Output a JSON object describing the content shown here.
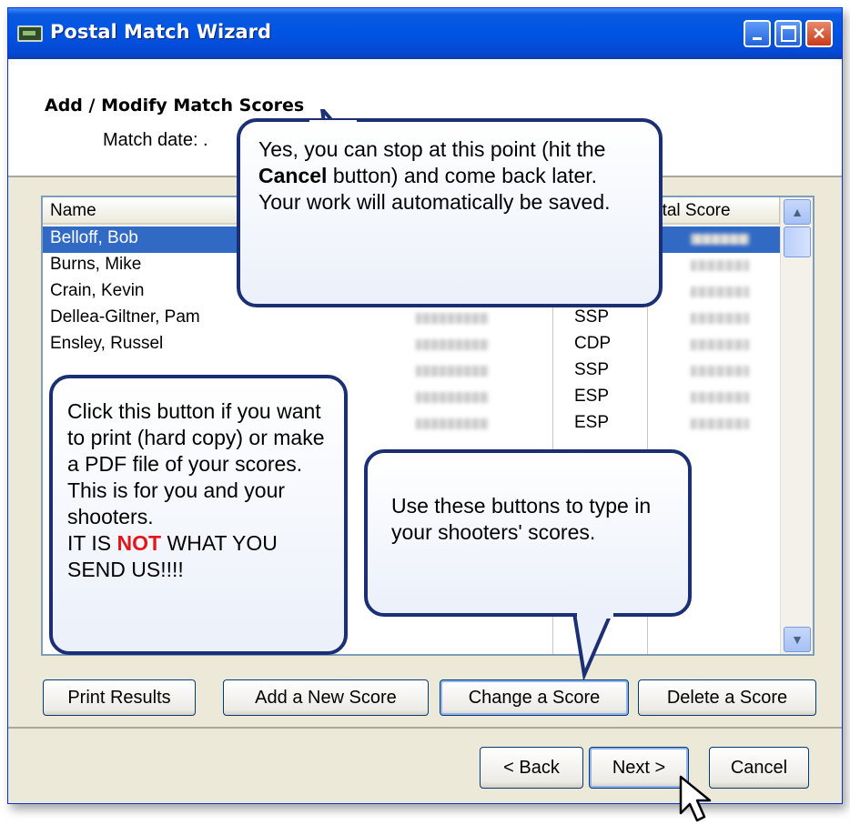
{
  "window": {
    "title": "Postal Match Wizard",
    "header_title": "Add / Modify Match Scores",
    "match_date_label": "Match date:  ."
  },
  "table": {
    "columns": [
      "Name",
      "",
      "",
      "otal Score"
    ],
    "rows": [
      {
        "name": "Belloff, Bob",
        "class": "",
        "selected": true
      },
      {
        "name": "Burns, Mike",
        "class": ""
      },
      {
        "name": "Crain, Kevin",
        "class": ""
      },
      {
        "name": "Dellea-Giltner, Pam",
        "class": "SSP"
      },
      {
        "name": "Ensley, Russel",
        "class": "CDP"
      },
      {
        "name": "",
        "class": "SSP"
      },
      {
        "name": "",
        "class": "ESP"
      },
      {
        "name": "",
        "class": "ESP"
      }
    ]
  },
  "buttons": {
    "print": "Print Results",
    "add": "Add a New Score",
    "change": "Change a Score",
    "delete": "Delete a Score",
    "back": "< Back",
    "next": "Next >",
    "cancel": "Cancel"
  },
  "callouts": {
    "cancel_note": {
      "before": "Yes, you can stop at this point (hit the",
      "bold": "Cancel",
      "after": "button) and come back later.  Your work will automatically be saved."
    },
    "print_note": {
      "before": "Click this button if you want to print (hard copy) or make a PDF file of your scores. This is for you and your shooters.",
      "caps_before": "IT IS",
      "red": "NOT",
      "caps_after": "WHAT YOU SEND US!!!!"
    },
    "buttons_note": "Use these buttons to type in your shooters' scores."
  },
  "colors": {
    "titlebar": "#0054e3",
    "selection": "#316ac5",
    "callout_border": "#1b2f74",
    "warning_red": "#e3161b"
  },
  "icons": [
    "app-icon",
    "minimize-icon",
    "maximize-icon",
    "close-icon",
    "scroll-up-icon",
    "scroll-down-icon",
    "mouse-cursor-icon"
  ]
}
